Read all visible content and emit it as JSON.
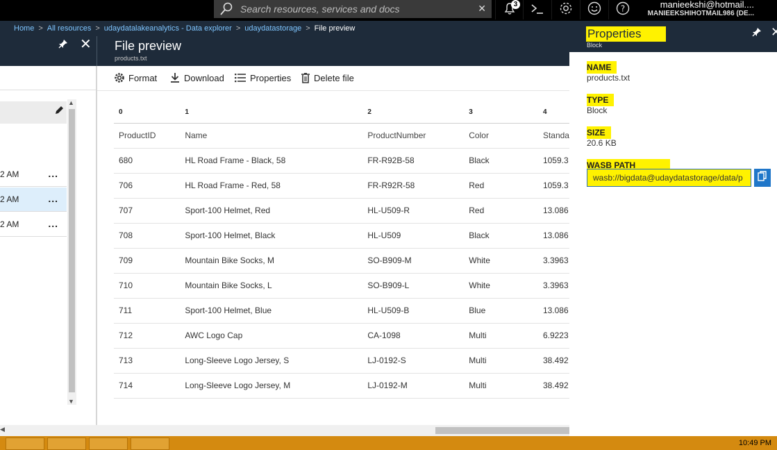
{
  "topbar": {
    "search_placeholder": "Search resources, services and docs",
    "clear": "✕",
    "notification_count": "3",
    "account_user": "manieekshi@hotmail....",
    "account_directory": "MANIEEKSHIHOTMAIL986 (DE..."
  },
  "breadcrumb": {
    "items": [
      "Home",
      "All resources",
      "udaydatalakeanalytics - Data explorer",
      "udaydatastorage",
      "File preview"
    ],
    "separator": ">"
  },
  "left_blade": {
    "rows": [
      {
        "time": "2 AM",
        "more": "..."
      },
      {
        "time": "2 AM",
        "more": "..."
      },
      {
        "time": "2 AM",
        "more": "..."
      }
    ]
  },
  "file_preview": {
    "title": "File preview",
    "subtitle": "products.txt",
    "toolbar": {
      "format": "Format",
      "download": "Download",
      "properties": "Properties",
      "delete": "Delete file"
    },
    "column_indexes": [
      "0",
      "1",
      "2",
      "3",
      "4"
    ],
    "headers": [
      "ProductID",
      "Name",
      "ProductNumber",
      "Color",
      "Standa"
    ],
    "rows": [
      [
        "680",
        "HL Road Frame - Black, 58",
        "FR-R92B-58",
        "Black",
        "1059.3"
      ],
      [
        "706",
        "HL Road Frame - Red, 58",
        "FR-R92R-58",
        "Red",
        "1059.3"
      ],
      [
        "707",
        "Sport-100 Helmet, Red",
        "HL-U509-R",
        "Red",
        "13.086"
      ],
      [
        "708",
        "Sport-100 Helmet, Black",
        "HL-U509",
        "Black",
        "13.086"
      ],
      [
        "709",
        "Mountain Bike Socks, M",
        "SO-B909-M",
        "White",
        "3.3963"
      ],
      [
        "710",
        "Mountain Bike Socks, L",
        "SO-B909-L",
        "White",
        "3.3963"
      ],
      [
        "711",
        "Sport-100 Helmet, Blue",
        "HL-U509-B",
        "Blue",
        "13.086"
      ],
      [
        "712",
        "AWC Logo Cap",
        "CA-1098",
        "Multi",
        "6.9223"
      ],
      [
        "713",
        "Long-Sleeve Logo Jersey, S",
        "LJ-0192-S",
        "Multi",
        "38.492"
      ],
      [
        "714",
        "Long-Sleeve Logo Jersey, M",
        "LJ-0192-M",
        "Multi",
        "38.492"
      ]
    ]
  },
  "properties": {
    "title": "Properties",
    "subtitle": "Block",
    "name_label": "NAME",
    "name_value": "products.txt",
    "type_label": "TYPE",
    "type_value": "Block",
    "size_label": "SIZE",
    "size_value": "20.6 KB",
    "path_label": "WASB PATH",
    "path_value": "wasb://bigdata@udaydatastorage/data/p"
  },
  "taskbar": {
    "clock": "10:49 PM"
  },
  "colors": {
    "topbar": "#000000",
    "header_band": "#1e2b3a",
    "highlight": "#fff200",
    "link": "#7ec5ff",
    "accent_button": "#1f76c9",
    "taskbar": "#d48a10"
  }
}
